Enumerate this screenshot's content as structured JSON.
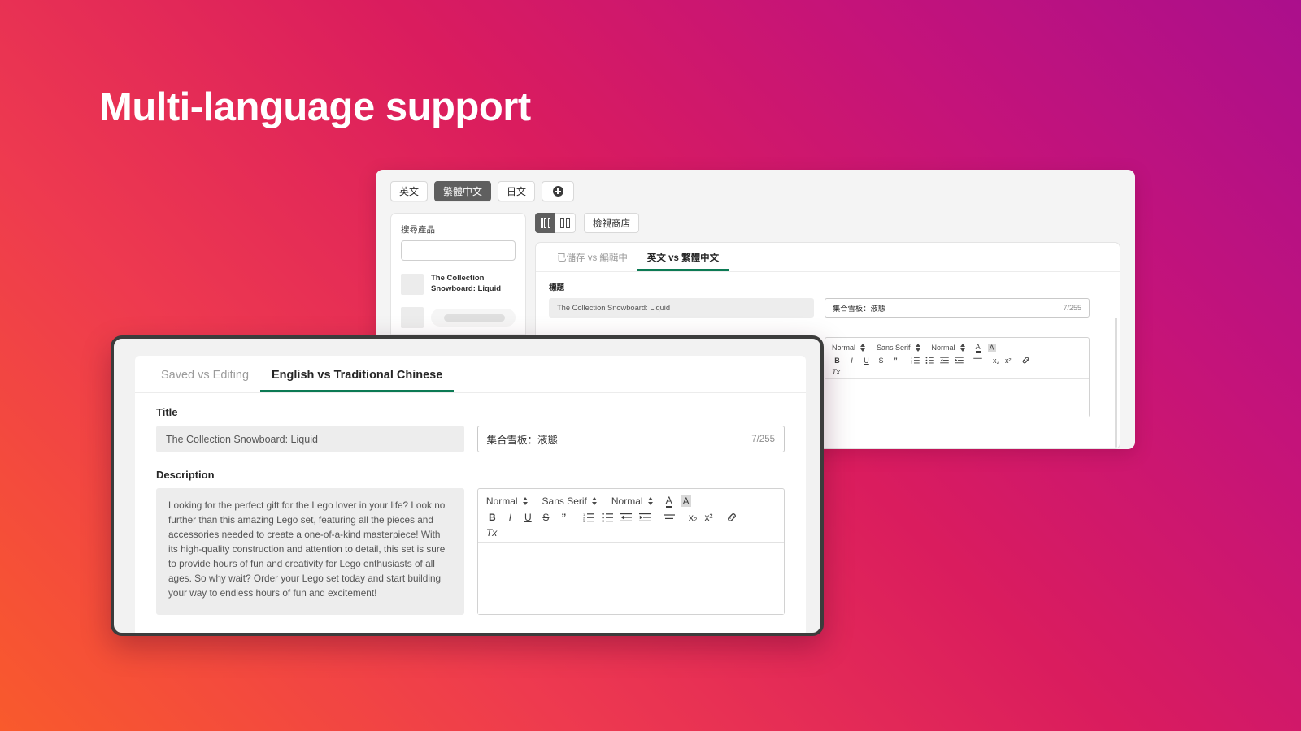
{
  "headline": "Multi-language support",
  "theme": {
    "gradient_start": "#f95a2c",
    "gradient_end": "#ab0f8c",
    "accent_green": "#0c7a54",
    "chip_active_bg": "#5f5f5f",
    "window_border": "#3c3c3c"
  },
  "back_window": {
    "languages": [
      {
        "label": "英文",
        "active": false
      },
      {
        "label": "繁體中文",
        "active": true
      },
      {
        "label": "日文",
        "active": false
      }
    ],
    "add_language_label": "+",
    "sidebar": {
      "search_label": "搜尋產品",
      "search_value": "",
      "search_placeholder": "",
      "products": [
        {
          "title": "The Collection Snowboard: Liquid",
          "skeleton": false
        },
        {
          "title": "",
          "skeleton": true
        },
        {
          "title": "",
          "skeleton": true
        }
      ]
    },
    "view_toggle": {
      "three_column_label": "",
      "two_column_label": "",
      "active": "three_column"
    },
    "view_store_label": "檢視商店",
    "tabs": [
      {
        "label": "已儲存 vs 編輯中",
        "active": false
      },
      {
        "label": "英文 vs 繁體中文",
        "active": true
      }
    ],
    "title_label": "標題",
    "title_source": "The Collection Snowboard: Liquid",
    "title_target": "集合雪板：液態",
    "title_counter": "7/255",
    "editor_toolbar": {
      "heading_select": "Normal",
      "font_select": "Sans Serif",
      "size_select": "Normal",
      "text_color_label": "A",
      "background_color_label": "A",
      "bold": "B",
      "italic": "I",
      "underline": "U",
      "strike": "S",
      "blockquote": "”",
      "ordered_list": "ordered-list",
      "bullet_list": "bullet-list",
      "outdent": "outdent",
      "indent": "indent",
      "align": "align",
      "subscript": "x₂",
      "superscript": "x²",
      "link": "link",
      "clear_format": "Tx"
    },
    "editor_body": ""
  },
  "front_window": {
    "tabs": [
      {
        "label": "Saved vs Editing",
        "active": false
      },
      {
        "label": "English vs Traditional Chinese",
        "active": true
      }
    ],
    "title_label": "Title",
    "title_source": "The Collection Snowboard: Liquid",
    "title_target": "集合雪板：液態",
    "title_counter": "7/255",
    "description_label": "Description",
    "description_source": "Looking for the perfect gift for the Lego lover in your life? Look no further than this amazing Lego set, featuring all the pieces and accessories needed to create a one-of-a-kind masterpiece! With its high-quality construction and attention to detail, this set is sure to provide hours of fun and creativity for Lego enthusiasts of all ages. So why wait? Order your Lego set today and start building your way to endless hours of fun and excitement!",
    "editor_toolbar": {
      "heading_select": "Normal",
      "font_select": "Sans Serif",
      "size_select": "Normal",
      "text_color_label": "A",
      "background_color_label": "A",
      "bold": "B",
      "italic": "I",
      "underline": "U",
      "strike": "S",
      "blockquote": "”",
      "ordered_list": "ordered-list",
      "bullet_list": "bullet-list",
      "outdent": "outdent",
      "indent": "indent",
      "align": "align",
      "subscript": "x₂",
      "superscript": "x²",
      "link": "link",
      "clear_format": "Tx"
    },
    "editor_body": ""
  }
}
